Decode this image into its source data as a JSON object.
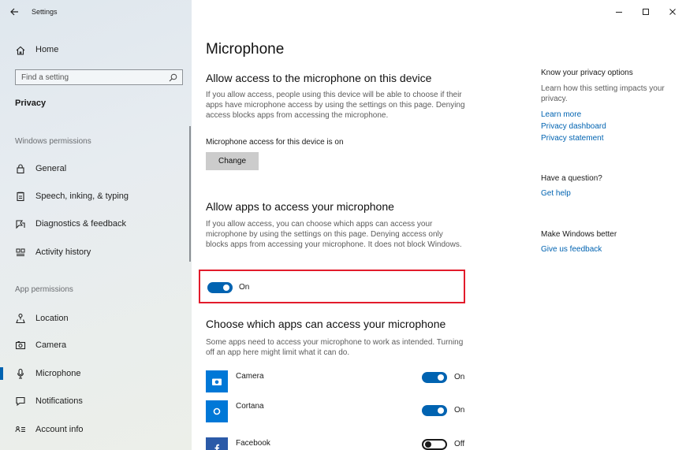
{
  "window": {
    "title": "Settings",
    "back_icon": "arrow-left-icon",
    "controls": [
      "minimize-icon",
      "maximize-icon",
      "close-icon"
    ]
  },
  "sidebar": {
    "home_label": "Home",
    "search_placeholder": "Find a setting",
    "category": "Privacy",
    "windows_permissions_label": "Windows permissions",
    "windows_permissions_items": [
      {
        "label": "General",
        "icon": "lock-icon"
      },
      {
        "label": "Speech, inking, & typing",
        "icon": "notepad-icon"
      },
      {
        "label": "Diagnostics & feedback",
        "icon": "feedback-icon"
      },
      {
        "label": "Activity history",
        "icon": "timeline-icon"
      }
    ],
    "app_permissions_label": "App permissions",
    "app_permissions_items": [
      {
        "label": "Location",
        "icon": "location-icon"
      },
      {
        "label": "Camera",
        "icon": "camera-icon"
      },
      {
        "label": "Microphone",
        "icon": "microphone-icon",
        "selected": true
      },
      {
        "label": "Notifications",
        "icon": "notification-icon"
      },
      {
        "label": "Account info",
        "icon": "account-info-icon"
      }
    ]
  },
  "main": {
    "title": "Microphone",
    "device_section": {
      "heading": "Allow access to the microphone on this device",
      "description": "If you allow access, people using this device will be able to choose if their apps have microphone access by using the settings on this page. Denying access blocks apps from accessing the microphone.",
      "status": "Microphone access for this device is on",
      "button_label": "Change"
    },
    "apps_section": {
      "heading": "Allow apps to access your microphone",
      "description": "If you allow access, you can choose which apps can access your microphone by using the settings on this page. Denying access only blocks apps from accessing your microphone. It does not block Windows.",
      "toggle_label": "On",
      "toggle_on": true
    },
    "choose_section": {
      "heading": "Choose which apps can access your microphone",
      "description": "Some apps need to access your microphone to work as intended. Turning off an app here might limit what it can do.",
      "apps": [
        {
          "name": "Camera",
          "icon": "camera-icon",
          "state_label": "On",
          "on": true
        },
        {
          "name": "Cortana",
          "icon": "cortana-icon",
          "state_label": "On",
          "on": true
        },
        {
          "name": "Facebook",
          "icon": "facebook-icon",
          "state_label": "Off",
          "on": false
        }
      ]
    }
  },
  "right_column": {
    "privacy_heading": "Know your privacy options",
    "privacy_desc": "Learn how this setting impacts your privacy.",
    "links": [
      "Learn more",
      "Privacy dashboard",
      "Privacy statement"
    ],
    "question_heading": "Have a question?",
    "help_link": "Get help",
    "better_heading": "Make Windows better",
    "feedback_link": "Give us feedback"
  },
  "colors": {
    "accent": "#0063b1",
    "highlight": "#e21b2b",
    "app_tile": "#0078d7"
  }
}
